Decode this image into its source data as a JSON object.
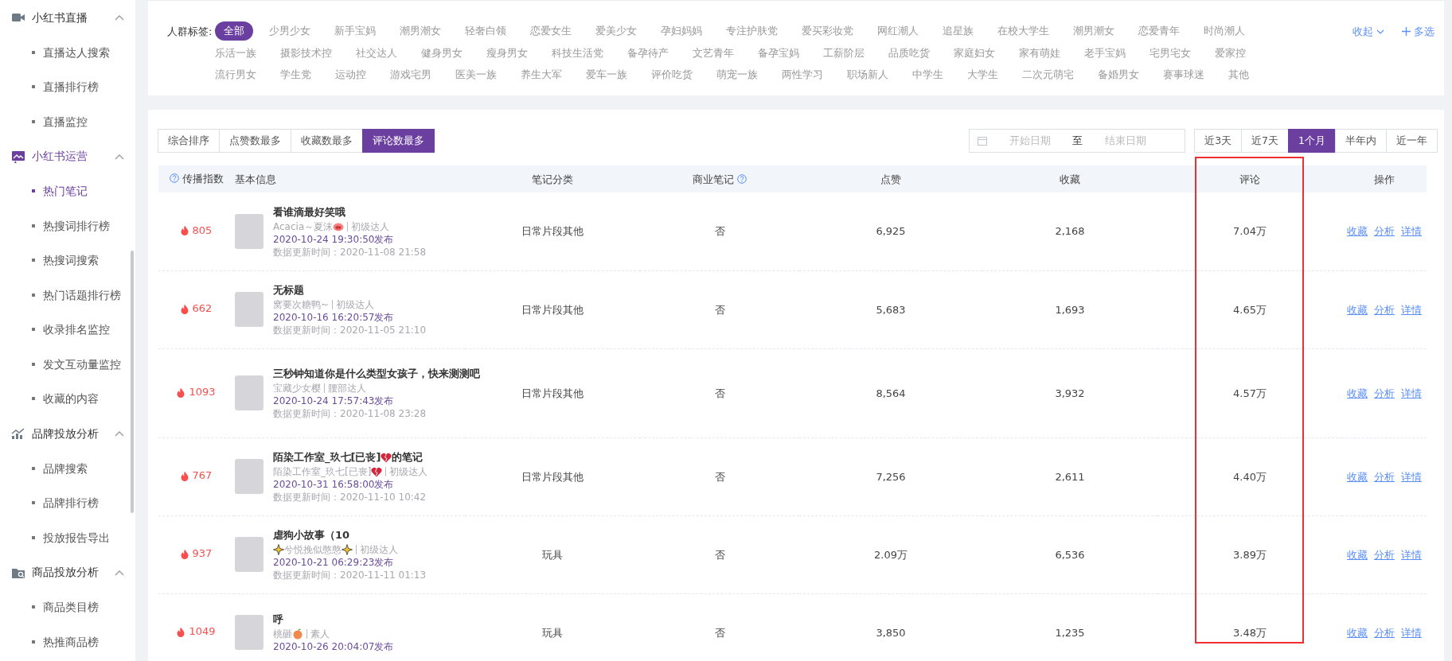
{
  "sidebar": {
    "groups": [
      {
        "label": "小红书直播",
        "kind": "video",
        "expanded": true,
        "selected": false,
        "items": [
          {
            "label": "直播达人搜索",
            "selected": false
          },
          {
            "label": "直播排行榜",
            "selected": false
          },
          {
            "label": "直播监控",
            "selected": false
          }
        ]
      },
      {
        "label": "小红书运营",
        "kind": "picture",
        "expanded": true,
        "selected": true,
        "items": [
          {
            "label": "热门笔记",
            "selected": true
          },
          {
            "label": "热搜词排行榜",
            "selected": false
          },
          {
            "label": "热搜词搜索",
            "selected": false
          },
          {
            "label": "热门话题排行榜",
            "selected": false
          },
          {
            "label": "收录排名监控",
            "selected": false
          },
          {
            "label": "发文互动量监控",
            "selected": false
          },
          {
            "label": "收藏的内容",
            "selected": false
          }
        ]
      },
      {
        "label": "品牌投放分析",
        "kind": "trend",
        "expanded": true,
        "selected": false,
        "items": [
          {
            "label": "品牌搜索",
            "selected": false
          },
          {
            "label": "品牌排行榜",
            "selected": false
          },
          {
            "label": "投放报告导出",
            "selected": false
          }
        ]
      },
      {
        "label": "商品投放分析",
        "kind": "folder",
        "expanded": true,
        "selected": false,
        "items": [
          {
            "label": "商品类目榜",
            "selected": false
          },
          {
            "label": "热推商品榜",
            "selected": false
          }
        ]
      }
    ]
  },
  "audience_filter": {
    "label": "人群标签:",
    "collapse": "收起",
    "multi_select": "多选",
    "tags": [
      {
        "label": "全部",
        "selected": true
      },
      {
        "label": "少男少女",
        "selected": false
      },
      {
        "label": "新手宝妈",
        "selected": false
      },
      {
        "label": "潮男潮女",
        "selected": false
      },
      {
        "label": "轻奢白领",
        "selected": false
      },
      {
        "label": "恋爱女生",
        "selected": false
      },
      {
        "label": "爱美少女",
        "selected": false
      },
      {
        "label": "孕妇妈妈",
        "selected": false
      },
      {
        "label": "专注护肤党",
        "selected": false
      },
      {
        "label": "爱买彩妆党",
        "selected": false
      },
      {
        "label": "网红潮人",
        "selected": false
      },
      {
        "label": "追星族",
        "selected": false
      },
      {
        "label": "在校大学生",
        "selected": false
      },
      {
        "label": "潮男潮女",
        "selected": false
      },
      {
        "label": "恋爱青年",
        "selected": false
      },
      {
        "label": "时尚潮人",
        "selected": false
      },
      {
        "label": "乐活一族",
        "selected": false
      },
      {
        "label": "摄影技术控",
        "selected": false
      },
      {
        "label": "社交达人",
        "selected": false
      },
      {
        "label": "健身男女",
        "selected": false
      },
      {
        "label": "瘦身男女",
        "selected": false
      },
      {
        "label": "科技生活党",
        "selected": false
      },
      {
        "label": "备孕待产",
        "selected": false
      },
      {
        "label": "文艺青年",
        "selected": false
      },
      {
        "label": "备孕宝妈",
        "selected": false
      },
      {
        "label": "工薪阶层",
        "selected": false
      },
      {
        "label": "品质吃货",
        "selected": false
      },
      {
        "label": "家庭妇女",
        "selected": false
      },
      {
        "label": "家有萌娃",
        "selected": false
      },
      {
        "label": "老手宝妈",
        "selected": false
      },
      {
        "label": "宅男宅女",
        "selected": false
      },
      {
        "label": "爱家控",
        "selected": false
      },
      {
        "label": "流行男女",
        "selected": false
      },
      {
        "label": "学生党",
        "selected": false
      },
      {
        "label": "运动控",
        "selected": false
      },
      {
        "label": "游戏宅男",
        "selected": false
      },
      {
        "label": "医美一族",
        "selected": false
      },
      {
        "label": "养生大军",
        "selected": false
      },
      {
        "label": "爱车一族",
        "selected": false
      },
      {
        "label": "评价吃货",
        "selected": false
      },
      {
        "label": "萌宠一族",
        "selected": false
      },
      {
        "label": "两性学习",
        "selected": false
      },
      {
        "label": "职场新人",
        "selected": false
      },
      {
        "label": "中学生",
        "selected": false
      },
      {
        "label": "大学生",
        "selected": false
      },
      {
        "label": "二次元萌宅",
        "selected": false
      },
      {
        "label": "备婚男女",
        "selected": false
      },
      {
        "label": "赛事球迷",
        "selected": false
      },
      {
        "label": "其他",
        "selected": false
      }
    ]
  },
  "sort_buttons": [
    {
      "label": "综合排序",
      "selected": false
    },
    {
      "label": "点赞数最多",
      "selected": false
    },
    {
      "label": "收藏数最多",
      "selected": false
    },
    {
      "label": "评论数最多",
      "selected": true
    }
  ],
  "date_range": {
    "start_placeholder": "开始日期",
    "separator": "至",
    "end_placeholder": "结束日期"
  },
  "period_buttons": [
    {
      "label": "近3天",
      "selected": false
    },
    {
      "label": "近7天",
      "selected": false
    },
    {
      "label": "1个月",
      "selected": true
    },
    {
      "label": "半年内",
      "selected": false
    },
    {
      "label": "近一年",
      "selected": false
    }
  ],
  "table": {
    "columns": [
      {
        "label": "传播指数",
        "help": true
      },
      {
        "label": "基本信息",
        "help": false
      },
      {
        "label": "笔记分类",
        "help": false
      },
      {
        "label": "商业笔记",
        "help": true
      },
      {
        "label": "点赞",
        "help": false
      },
      {
        "label": "收藏",
        "help": false
      },
      {
        "label": "评论",
        "help": false,
        "highlighted": true
      },
      {
        "label": "操作",
        "help": false
      }
    ],
    "rows": [
      {
        "index": "805",
        "title": [
          {
            "kind": "text",
            "text": "看谁滴最好笑哦"
          }
        ],
        "author": [
          {
            "kind": "text",
            "text": "Acacia～夏沫"
          },
          {
            "kind": "pig-nose"
          }
        ],
        "level": "初级达人",
        "published": "2020-10-24 19:30:50发布",
        "updated": "数据更新时间：2020-11-08 21:58",
        "category": "日常片段其他",
        "commercial": "否",
        "likes": "6,925",
        "favorites": "2,168",
        "comments": "7.04万",
        "actions": [
          "收藏",
          "分析",
          "详情"
        ]
      },
      {
        "index": "662",
        "title": [
          {
            "kind": "text",
            "text": "无标题"
          }
        ],
        "author": [
          {
            "kind": "text",
            "text": "窝要次糖鸭~"
          }
        ],
        "level": "初级达人",
        "published": "2020-10-16 16:20:57发布",
        "updated": "数据更新时间：2020-11-05 21:10",
        "category": "日常片段其他",
        "commercial": "否",
        "likes": "5,683",
        "favorites": "1,693",
        "comments": "4.65万",
        "actions": [
          "收藏",
          "分析",
          "详情"
        ]
      },
      {
        "index": "1093",
        "title": [
          {
            "kind": "text",
            "text": "三秒钟知道你是什么类型女孩子，快来测测吧"
          }
        ],
        "author": [
          {
            "kind": "text",
            "text": "宝藏少女樱"
          }
        ],
        "level": "腰部达人",
        "published": "2020-10-24 17:57:43发布",
        "updated": "数据更新时间：2020-11-08 23:28",
        "category": "日常片段其他",
        "commercial": "否",
        "likes": "8,564",
        "favorites": "3,932",
        "comments": "4.57万",
        "actions": [
          "收藏",
          "分析",
          "详情"
        ]
      },
      {
        "index": "767",
        "title": [
          {
            "kind": "text",
            "text": "陌染工作室_玖七[已丧]"
          },
          {
            "kind": "broken-heart"
          },
          {
            "kind": "text",
            "text": "的笔记"
          }
        ],
        "author": [
          {
            "kind": "text",
            "text": "陌染工作室_玖七[已丧]"
          },
          {
            "kind": "broken-heart"
          }
        ],
        "level": "初级达人",
        "published": "2020-10-31 16:58:00发布",
        "updated": "数据更新时间：2020-11-10 10:42",
        "category": "日常片段其他",
        "commercial": "否",
        "likes": "7,256",
        "favorites": "2,611",
        "comments": "4.40万",
        "actions": [
          "收藏",
          "分析",
          "详情"
        ]
      },
      {
        "index": "937",
        "title": [
          {
            "kind": "text",
            "text": "虐狗小故事（10"
          }
        ],
        "author": [
          {
            "kind": "sparkle"
          },
          {
            "kind": "text",
            "text": "兮悦挽似憨憨"
          },
          {
            "kind": "sparkle"
          }
        ],
        "level": "初级达人",
        "published": "2020-10-21 06:29:23发布",
        "updated": "数据更新时间：2020-11-11 01:13",
        "category": "玩具",
        "commercial": "否",
        "likes": "2.09万",
        "favorites": "6,536",
        "comments": "3.89万",
        "actions": [
          "收藏",
          "分析",
          "详情"
        ]
      },
      {
        "index": "1049",
        "title": [
          {
            "kind": "text",
            "text": "呼"
          }
        ],
        "author": [
          {
            "kind": "text",
            "text": "桃砸"
          },
          {
            "kind": "peach"
          }
        ],
        "level": "素人",
        "published": "2020-10-26 20:04:07发布",
        "category": "玩具",
        "commercial": "否",
        "likes": "3,850",
        "favorites": "1,235",
        "comments": "3.48万",
        "actions": [
          "收藏",
          "分析",
          "详情"
        ]
      }
    ]
  }
}
